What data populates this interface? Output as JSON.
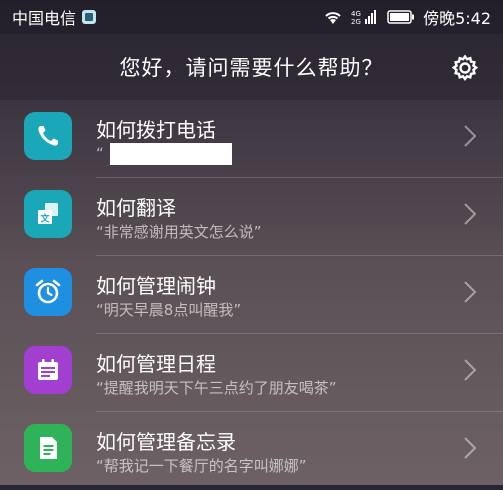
{
  "status_bar": {
    "carrier": "中国电信",
    "time": "傍晚5:42",
    "signal_label": "4G",
    "signal_label2": "2G"
  },
  "header": {
    "title": "您好，请问需要什么帮助？",
    "settings_icon": "gear-icon"
  },
  "items": [
    {
      "title": "如何拨打电话",
      "subtitle": "“",
      "icon": "phone-icon",
      "color": "#1aa7b8"
    },
    {
      "title": "如何翻译",
      "subtitle": "“非常感谢用英文怎么说”",
      "icon": "translate-icon",
      "color": "#1aa7b8"
    },
    {
      "title": "如何管理闹钟",
      "subtitle": "“明天早晨8点叫醒我”",
      "icon": "alarm-icon",
      "color": "#1f8fe1"
    },
    {
      "title": "如何管理日程",
      "subtitle": "“提醒我明天下午三点约了朋友喝茶”",
      "icon": "calendar-icon",
      "color": "#a33fd0"
    },
    {
      "title": "如何管理备忘录",
      "subtitle": "“帮我记一下餐厅的名字叫娜娜”",
      "icon": "memo-icon",
      "color": "#2fb35a"
    }
  ]
}
